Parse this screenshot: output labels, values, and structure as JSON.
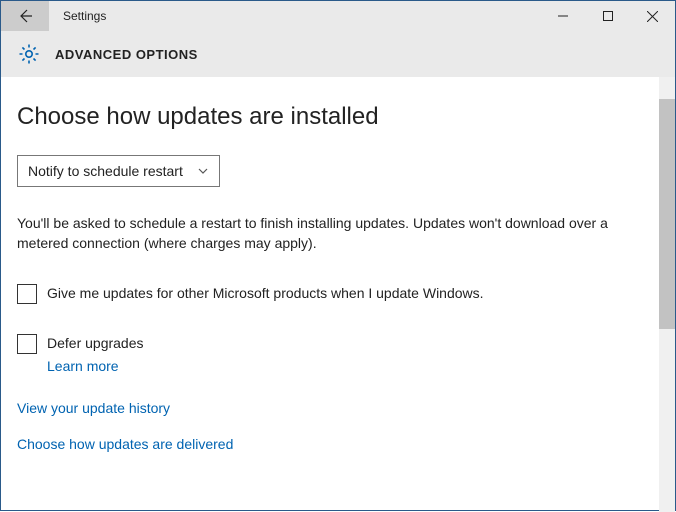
{
  "window": {
    "title": "Settings"
  },
  "header": {
    "title": "ADVANCED OPTIONS"
  },
  "main": {
    "heading": "Choose how updates are installed",
    "dropdown_value": "Notify to schedule restart",
    "description": "You'll be asked to schedule a restart to finish installing updates. Updates won't download over a metered connection (where charges may apply).",
    "checkbox_other_products": "Give me updates for other Microsoft products when I update Windows.",
    "checkbox_defer": "Defer upgrades",
    "learn_more": "Learn more",
    "link_history": "View your update history",
    "link_delivery": "Choose how updates are delivered"
  },
  "checkboxes": {
    "other_products_checked": false,
    "defer_checked": false
  },
  "colors": {
    "link": "#0063b1",
    "border": "#2a5a8a"
  }
}
